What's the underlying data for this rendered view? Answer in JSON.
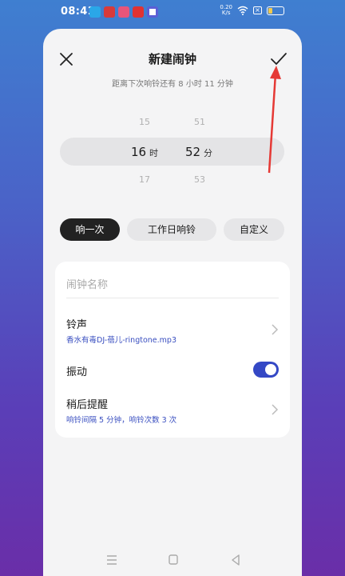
{
  "status_bar": {
    "time": "08:41",
    "net_speed_value": "0.20",
    "net_speed_unit": "K/s",
    "sim_label": "×",
    "battery_level": 0.25,
    "notification_icons": [
      "app-icon-blue",
      "app-icon-red",
      "app-icon-pink",
      "app-icon-red-logo",
      "app-icon-gear"
    ]
  },
  "header": {
    "title": "新建闹钟",
    "subtitle": "距离下次响铃还有 8 小时 11 分钟"
  },
  "time_picker": {
    "hour_prev": "15",
    "hour_selected": "16",
    "hour_unit": "时",
    "hour_next": "17",
    "minute_prev": "51",
    "minute_selected": "52",
    "minute_unit": "分",
    "minute_next": "53"
  },
  "repeat_options": {
    "once": "响一次",
    "workday": "工作日响铃",
    "custom": "自定义",
    "selected": "响一次"
  },
  "settings": {
    "name_placeholder": "闹钟名称",
    "ringtone_label": "铃声",
    "ringtone_value": "香水有毒DJ-蓓儿-ringtone.mp3",
    "vibrate_label": "振动",
    "vibrate_on": true,
    "snooze_label": "稍后提醒",
    "snooze_value": "响铃间隔 5 分钟，响铃次数 3 次"
  },
  "colors": {
    "accent": "#3448c5",
    "annotation_arrow": "#e53935"
  }
}
